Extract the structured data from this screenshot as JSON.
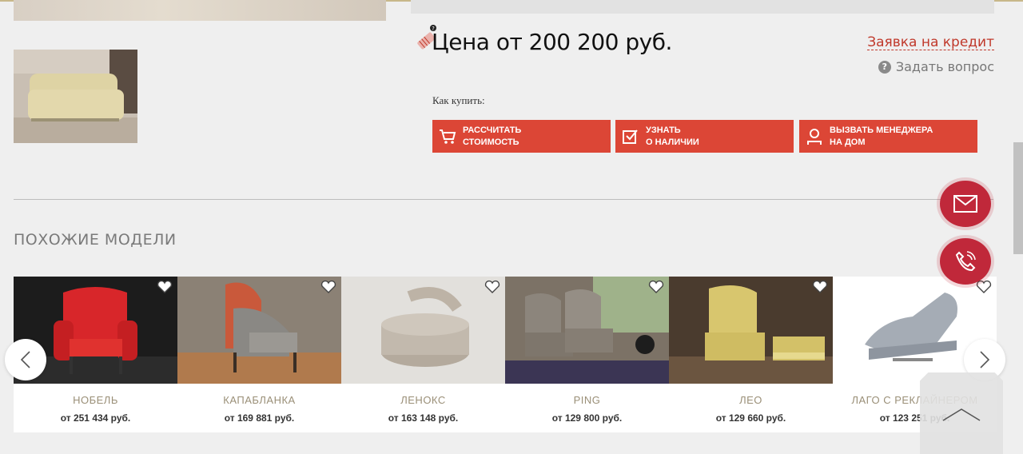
{
  "product": {
    "price": "Цена от 200 200 руб.",
    "credit_link": "Заявка на кредит",
    "ask_question": "Задать вопрос",
    "how_to_buy": "Как купить:"
  },
  "actions": [
    {
      "line1": "РАССЧИТАТЬ",
      "line2": "СТОИМОСТЬ",
      "icon": "cart-icon"
    },
    {
      "line1": "УЗНАТЬ",
      "line2": "О НАЛИЧИИ",
      "icon": "checkbox-icon"
    },
    {
      "line1": "ВЫЗВАТЬ МЕНЕДЖЕРА",
      "line2": "НА ДОМ",
      "icon": "user-icon"
    }
  ],
  "similar": {
    "title": "ПОХОЖИЕ МОДЕЛИ",
    "items": [
      {
        "name": "НОБЕЛЬ",
        "price": "от 251 434 руб."
      },
      {
        "name": "КАПАБЛАНКА",
        "price": "от 169 881 руб."
      },
      {
        "name": "ЛЕНОКС",
        "price": "от 163 148 руб."
      },
      {
        "name": "PING",
        "price": "от 129 800 руб."
      },
      {
        "name": "ЛЕО",
        "price": "от 129 660 руб."
      },
      {
        "name": "ЛАГО С РЕКЛАЙНЕРОМ",
        "price": "от 123 251 руб."
      }
    ]
  },
  "colors": {
    "accent": "#dc4636",
    "fab": "#c0283a",
    "gold": "#9a8f77"
  }
}
